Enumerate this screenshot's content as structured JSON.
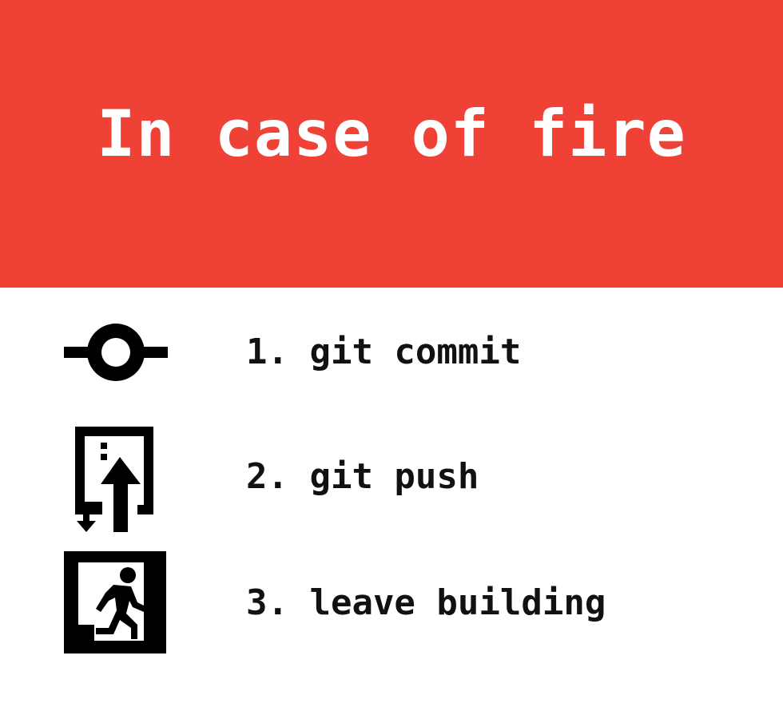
{
  "banner": {
    "title": "In case of fire",
    "color": "#ef4136"
  },
  "steps": [
    {
      "text": "1. git commit",
      "icon": "commit-icon"
    },
    {
      "text": "2. git push",
      "icon": "push-arrow-icon"
    },
    {
      "text": "3. leave building",
      "icon": "emergency-exit-icon"
    }
  ]
}
